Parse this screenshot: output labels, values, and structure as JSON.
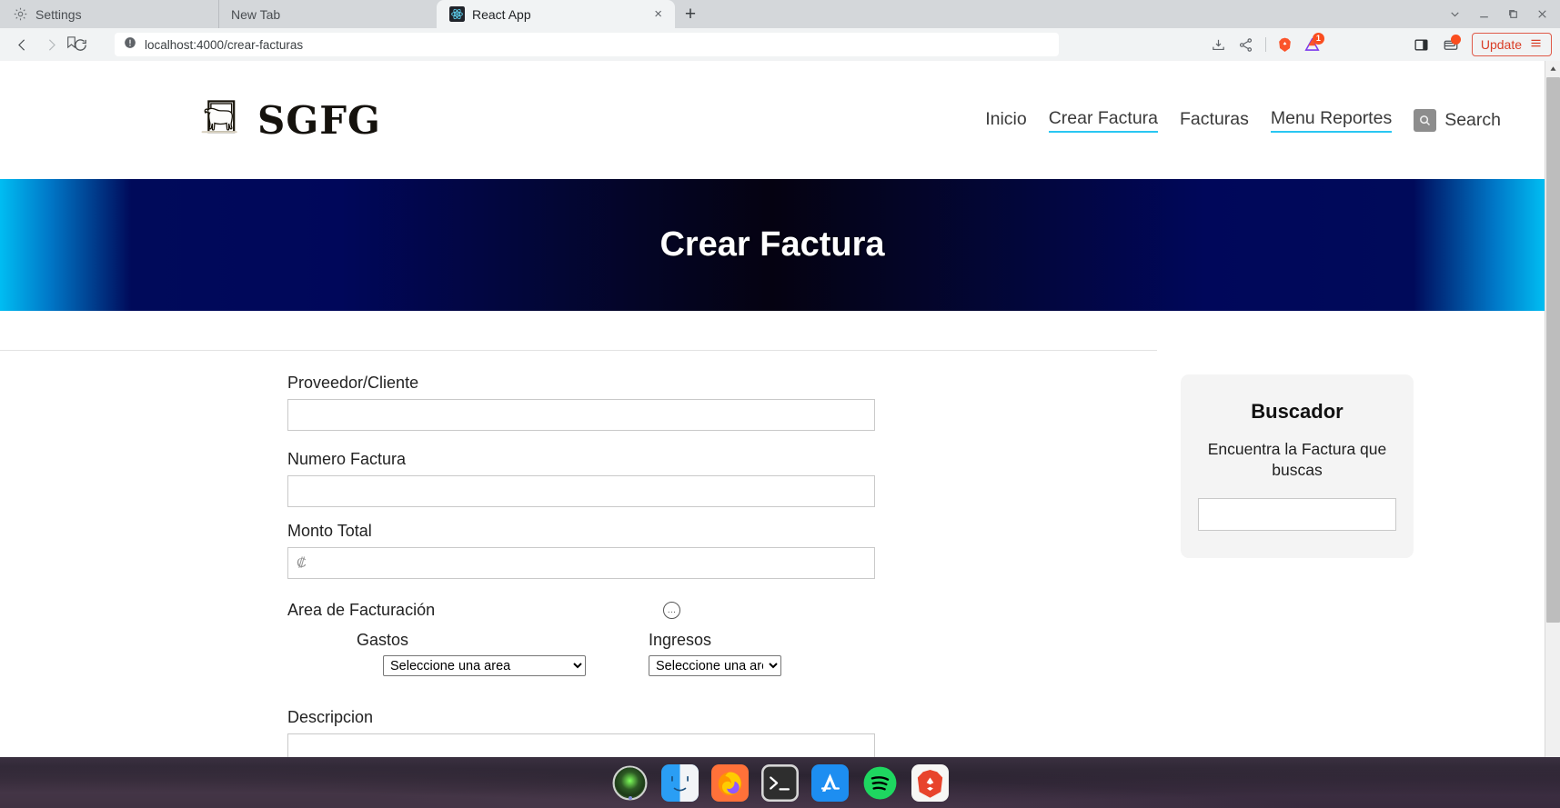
{
  "browser": {
    "tabs": [
      {
        "title": "Settings",
        "icon": "gear-icon",
        "active": false
      },
      {
        "title": "New Tab",
        "icon": "none",
        "active": false
      },
      {
        "title": "React App",
        "icon": "react-logo-icon",
        "active": true
      }
    ],
    "new_tab_label": "+",
    "close_label": "×",
    "window_controls": [
      "tab-search-chevron",
      "minimize",
      "maximize",
      "close"
    ],
    "url_host": "localhost:4000",
    "url_path": "/crear-facturas",
    "url_full": "localhost:4000/crear-facturas",
    "toolbar_icons": [
      "download-icon",
      "share-icon",
      "brave-lion-icon",
      "brave-rewards-triangle-icon",
      "sidebar-panel-icon",
      "wallet-icon"
    ],
    "rewards_badge": "1",
    "update_label": "Update",
    "back_icon": "back-arrow-icon",
    "forward_icon": "forward-arrow-icon",
    "reload_icon": "reload-icon",
    "bookmark_icon": "bookmark-icon",
    "site_info_icon": "info-circle-icon"
  },
  "site": {
    "logo_text": "SGFG",
    "logo_icon": "cow-logo-icon",
    "nav": [
      {
        "label": "Inicio",
        "underlined": false
      },
      {
        "label": "Crear Factura",
        "underlined": true
      },
      {
        "label": "Facturas",
        "underlined": false
      },
      {
        "label": "Menu Reportes",
        "underlined": true
      }
    ],
    "search_label": "Search",
    "search_icon": "search-icon"
  },
  "hero": {
    "title": "Crear Factura",
    "gradient_edge_color": "#00bdf2",
    "gradient_mid_color": "#00075a",
    "gradient_center_color": "#050211"
  },
  "form": {
    "fields": [
      {
        "label": "Proveedor/Cliente",
        "value": "",
        "placeholder": ""
      },
      {
        "label": "Numero Factura",
        "value": "",
        "placeholder": ""
      },
      {
        "label": "Monto Total",
        "value": "",
        "placeholder": "₡"
      }
    ],
    "area_label": "Area de Facturación",
    "area_info_icon": "three-dots-circle-icon",
    "gastos_label": "Gastos",
    "ingresos_label": "Ingresos",
    "select_placeholder": "Seleccione una area",
    "select_options": [
      "Seleccione una area"
    ],
    "descripcion_label": "Descripcion",
    "descripcion_value": "",
    "descripcion_placeholder": ""
  },
  "sidebar": {
    "title": "Buscador",
    "subtitle": "Encuentra la Factura que buscas",
    "search_value": "",
    "search_placeholder": ""
  },
  "scrollbar": {
    "up_arrow": "▲",
    "down_arrow": "▼"
  },
  "dock": {
    "items": [
      "radar-green-icon",
      "finder-icon",
      "firefox-icon",
      "terminal-icon",
      "app-store-icon",
      "spotify-icon",
      "brave-icon"
    ]
  }
}
